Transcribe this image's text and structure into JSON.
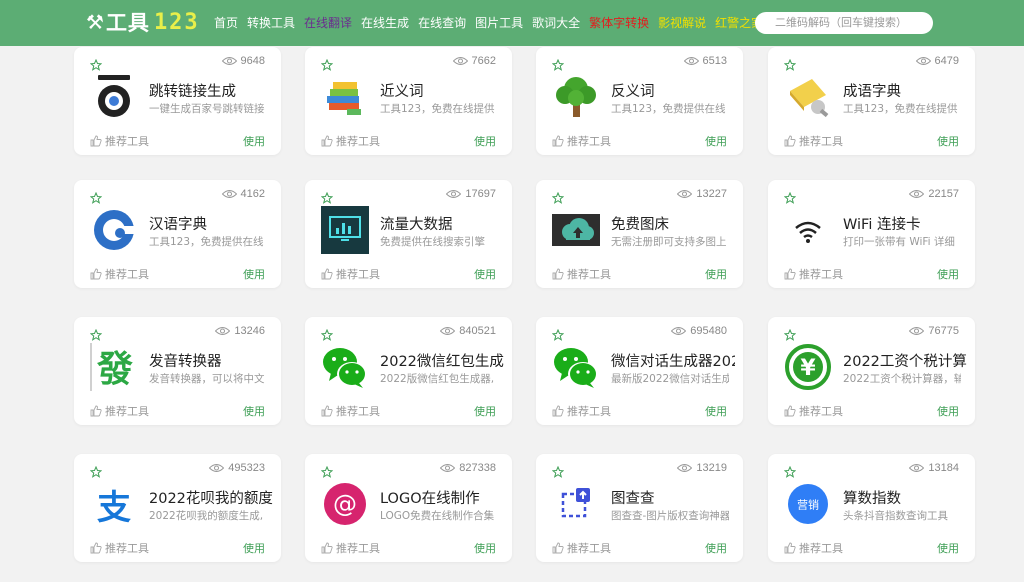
{
  "header": {
    "logo_mark": "⚒",
    "logo_cn": "工具",
    "logo_num": "123",
    "nav": [
      {
        "label": "首页",
        "color": "#ffffff"
      },
      {
        "label": "转换工具",
        "color": "#ffffff"
      },
      {
        "label": "在线翻译",
        "color": "#6b2d8f"
      },
      {
        "label": "在线生成",
        "color": "#ffffff"
      },
      {
        "label": "在线查询",
        "color": "#ffffff"
      },
      {
        "label": "图片工具",
        "color": "#ffffff"
      },
      {
        "label": "歌词大全",
        "color": "#ffffff"
      },
      {
        "label": "繁体字转换",
        "color": "#e02020"
      },
      {
        "label": "影视解说",
        "color": "#f0e000"
      },
      {
        "label": "红警之家",
        "color": "#f0e000"
      }
    ],
    "search_placeholder": "二维码解码（回车键搜索）"
  },
  "cards": [
    {
      "views": "9648",
      "title": "跳转链接生成",
      "desc": "一键生成百家号跳转链接",
      "icon": "redirect-logo-icon",
      "rec": "推荐工具",
      "use": "使用"
    },
    {
      "views": "7662",
      "title": "近义词",
      "desc": "工具123，免费在线提供",
      "icon": "books-icon",
      "rec": "推荐工具",
      "use": "使用"
    },
    {
      "views": "6513",
      "title": "反义词",
      "desc": "工具123，免费提供在线",
      "icon": "tree-icon",
      "rec": "推荐工具",
      "use": "使用"
    },
    {
      "views": "6479",
      "title": "成语字典",
      "desc": "工具123，免费在线提供",
      "icon": "dictionary-icon",
      "rec": "推荐工具",
      "use": "使用"
    },
    {
      "views": "4162",
      "title": "汉语字典",
      "desc": "工具123，免费提供在线",
      "icon": "g-logo-icon",
      "rec": "推荐工具",
      "use": "使用"
    },
    {
      "views": "17697",
      "title": "流量大数据",
      "desc": "免费提供在线搜索引擎",
      "icon": "chart-monitor-icon",
      "rec": "推荐工具",
      "use": "使用"
    },
    {
      "views": "13227",
      "title": "免费图床",
      "desc": "无需注册即可支持多图上",
      "icon": "cloud-upload-icon",
      "rec": "推荐工具",
      "use": "使用"
    },
    {
      "views": "22157",
      "title": "WiFi 连接卡",
      "desc": "打印一张带有 WiFi 详细",
      "icon": "wifi-icon",
      "rec": "推荐工具",
      "use": "使用"
    },
    {
      "views": "13246",
      "title": "发音转换器",
      "desc": "发音转换器，可以将中文",
      "icon": "fa-character-icon",
      "rec": "推荐工具",
      "use": "使用",
      "glyph": "發"
    },
    {
      "views": "840521",
      "title": "2022微信红包生成",
      "desc": "2022版微信红包生成器,",
      "icon": "wechat-icon",
      "rec": "推荐工具",
      "use": "使用"
    },
    {
      "views": "695480",
      "title": "微信对话生成器202",
      "desc": "最新版2022微信对话生成",
      "icon": "wechat-icon",
      "rec": "推荐工具",
      "use": "使用"
    },
    {
      "views": "76775",
      "title": "2022工资个税计算",
      "desc": "2022工资个税计算器，辅",
      "icon": "yen-circle-icon",
      "rec": "推荐工具",
      "use": "使用",
      "glyph": "¥"
    },
    {
      "views": "495323",
      "title": "2022花呗我的额度",
      "desc": "2022花呗我的额度生成,",
      "icon": "alipay-icon",
      "rec": "推荐工具",
      "use": "使用",
      "glyph": "支"
    },
    {
      "views": "827338",
      "title": "LOGO在线制作",
      "desc": "LOGO免费在线制作合集",
      "icon": "at-sign-icon",
      "rec": "推荐工具",
      "use": "使用",
      "glyph": "@"
    },
    {
      "views": "13219",
      "title": "图查查",
      "desc": "图查查-图片版权查询神器",
      "icon": "image-search-icon",
      "rec": "推荐工具",
      "use": "使用"
    },
    {
      "views": "13184",
      "title": "算数指数",
      "desc": "头条抖音指数查询工具",
      "icon": "marketing-badge-icon",
      "rec": "推荐工具",
      "use": "使用",
      "glyph": "营销"
    }
  ]
}
